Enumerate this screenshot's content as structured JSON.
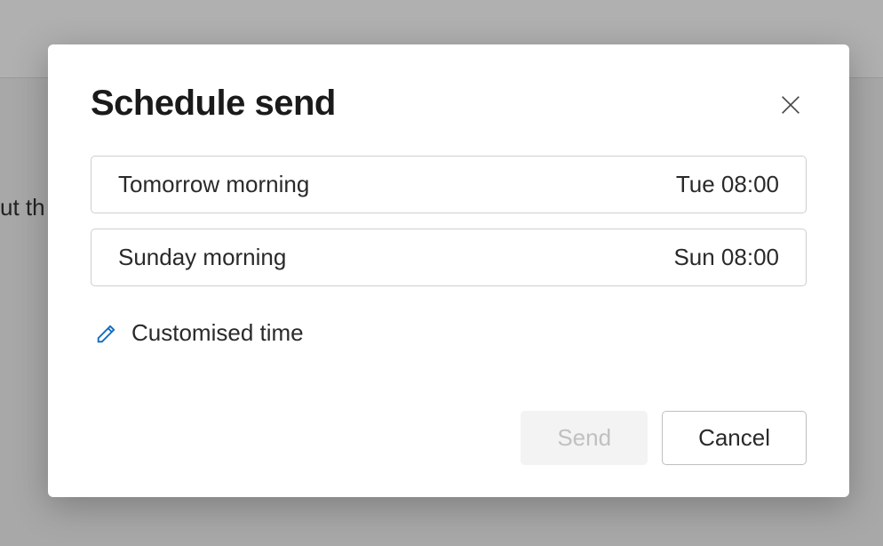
{
  "background": {
    "partial_text": "ut th"
  },
  "modal": {
    "title": "Schedule send",
    "options": [
      {
        "label": "Tomorrow morning",
        "time": "Tue 08:00"
      },
      {
        "label": "Sunday morning",
        "time": "Sun 08:00"
      }
    ],
    "custom_label": "Customised time",
    "buttons": {
      "send": "Send",
      "cancel": "Cancel"
    }
  }
}
